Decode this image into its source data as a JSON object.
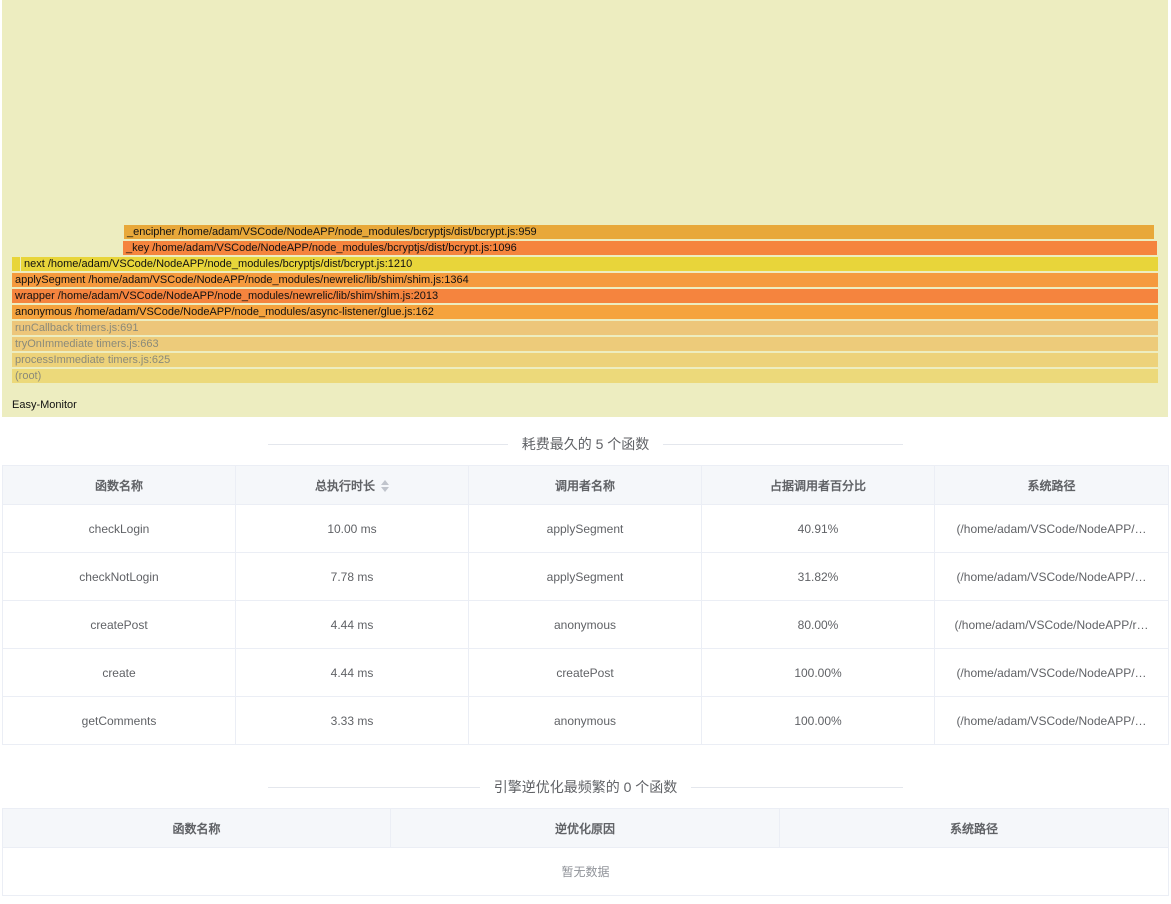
{
  "flamegraph": {
    "brand": "Easy-Monitor",
    "frames": [
      {
        "label": "_encipher /home/adam/VSCode/NodeAPP/node_modules/bcryptjs/dist/bcrypt.js:959",
        "color": "#e8a83a"
      },
      {
        "label": "_key /home/adam/VSCode/NodeAPP/node_modules/bcryptjs/dist/bcrypt.js:1096",
        "color": "#f5843e"
      },
      {
        "label": "next /home/adam/VSCode/NodeAPP/node_modules/bcryptjs/dist/bcrypt.js:1210",
        "color": "#e8d53a"
      },
      {
        "label": "applySegment /home/adam/VSCode/NodeAPP/node_modules/newrelic/lib/shim/shim.js:1364",
        "color": "#f59a3e"
      },
      {
        "label": "wrapper /home/adam/VSCode/NodeAPP/node_modules/newrelic/lib/shim/shim.js:2013",
        "color": "#f5843e"
      },
      {
        "label": "anonymous /home/adam/VSCode/NodeAPP/node_modules/async-listener/glue.js:162",
        "color": "#f5a33e"
      },
      {
        "label": "runCallback timers.js:691",
        "color": "#edc67a"
      },
      {
        "label": "tryOnImmediate timers.js:663",
        "color": "#edcb7a"
      },
      {
        "label": "processImmediate timers.js:625",
        "color": "#edd27a"
      },
      {
        "label": "(root)",
        "color": "#ecd97a"
      }
    ]
  },
  "top_functions": {
    "title": "耗费最久的 5 个函数",
    "headers": [
      "函数名称",
      "总执行时长",
      "调用者名称",
      "占据调用者百分比",
      "系统路径"
    ],
    "rows": [
      [
        "checkLogin",
        "10.00 ms",
        "applySegment",
        "40.91%",
        "(/home/adam/VSCode/NodeAPP/…"
      ],
      [
        "checkNotLogin",
        "7.78 ms",
        "applySegment",
        "31.82%",
        "(/home/adam/VSCode/NodeAPP/…"
      ],
      [
        "createPost",
        "4.44 ms",
        "anonymous",
        "80.00%",
        "(/home/adam/VSCode/NodeAPP/r…"
      ],
      [
        "create",
        "4.44 ms",
        "createPost",
        "100.00%",
        "(/home/adam/VSCode/NodeAPP/…"
      ],
      [
        "getComments",
        "3.33 ms",
        "anonymous",
        "100.00%",
        "(/home/adam/VSCode/NodeAPP/…"
      ]
    ]
  },
  "deopt_functions": {
    "title": "引擎逆优化最频繁的 0 个函数",
    "headers": [
      "函数名称",
      "逆优化原因",
      "系统路径"
    ],
    "empty_text": "暂无数据"
  }
}
